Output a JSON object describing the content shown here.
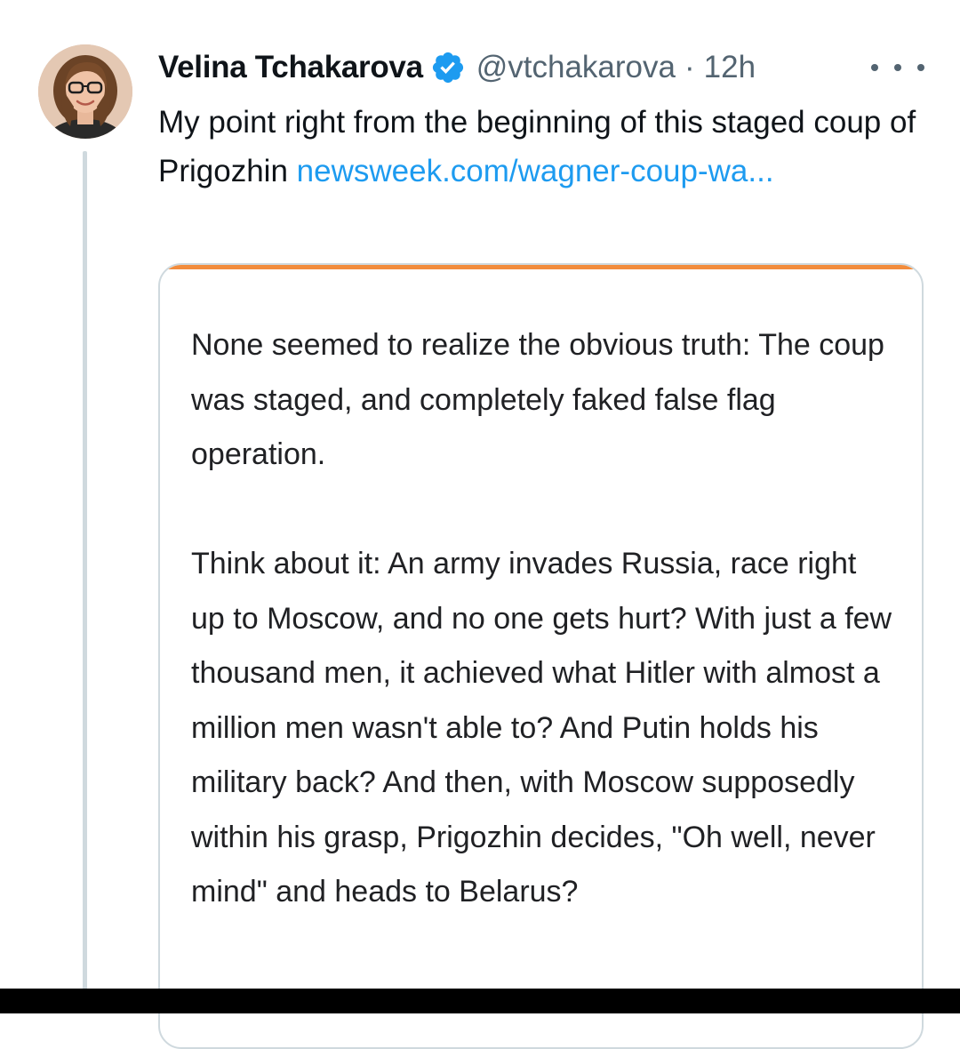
{
  "tweet": {
    "author": {
      "display_name": "Velina Tchakarova",
      "handle": "@vtchakarova",
      "verified_icon": "verified-badge-icon",
      "verified_color": "#1d9bf0"
    },
    "separator": "·",
    "timestamp": "12h",
    "more_icon": "more-horizontal-icon",
    "text": "My point right from the beginning of this staged coup of Prigozhin",
    "link_text": "newsweek.com/wagner-coup-wa...",
    "link_color": "#1d9bf0"
  },
  "quote": {
    "accent_color": "#f28c3c",
    "paragraph1": "None seemed to realize the obvious truth: The coup was staged, and completely faked false flag operation.",
    "paragraph2": "Think about it: An army invades Russia, race right up to Moscow, and no one gets hurt? With just a few thousand men, it achieved what Hitler with almost a million men wasn't able to? And Putin holds his military back? And then, with Moscow supposedly within his grasp, Prigozhin decides, \"Oh well, never mind\" and heads to Belarus?"
  }
}
